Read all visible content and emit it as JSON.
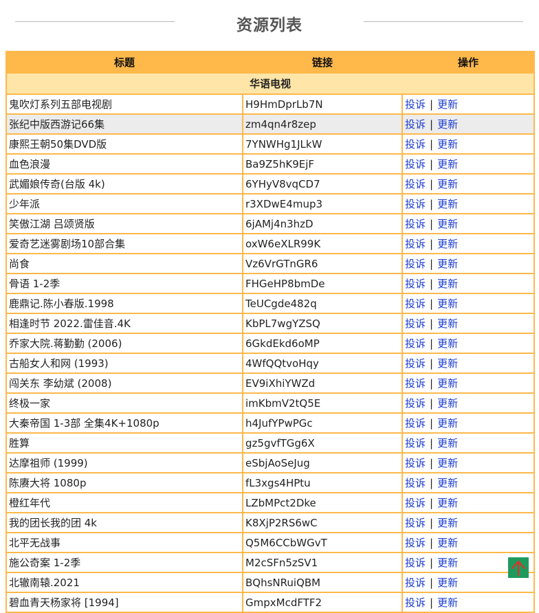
{
  "page": {
    "title": "资源列表"
  },
  "table": {
    "headers": [
      "标题",
      "链接",
      "操作"
    ],
    "category": "华语电视",
    "complain_label": "投诉",
    "separator": "|",
    "update_label": "更新",
    "rows": [
      {
        "title": "鬼吹灯系列五部电视剧",
        "link": "H9HmDprLb7N"
      },
      {
        "title": "张纪中版西游记66集",
        "link": "zm4qn4r8zep"
      },
      {
        "title": "康熙王朝50集DVD版",
        "link": "7YNWHg1JLkW"
      },
      {
        "title": "血色浪漫",
        "link": "Ba9Z5hK9EjF"
      },
      {
        "title": "武媚娘传奇(台版 4k)",
        "link": "6YHyV8vqCD7"
      },
      {
        "title": "少年派",
        "link": "r3XDwE4mup3"
      },
      {
        "title": "笑傲江湖 吕颂贤版",
        "link": "6jAMj4n3hzD"
      },
      {
        "title": "爱奇艺迷雾剧场10部合集",
        "link": "oxW6eXLR99K"
      },
      {
        "title": "尚食",
        "link": "Vz6VrGTnGR6"
      },
      {
        "title": "骨语 1-2季",
        "link": "FHGeHP8bmDe"
      },
      {
        "title": "鹿鼎记.陈小春版.1998",
        "link": "TeUCgde482q"
      },
      {
        "title": "相逢时节 2022.雷佳音.4K",
        "link": "KbPL7wgYZSQ"
      },
      {
        "title": "乔家大院.蒋勤勤 (2006)",
        "link": "6GkdEkd6oMP"
      },
      {
        "title": "古船女人和网 (1993)",
        "link": "4WfQQtvoHqy"
      },
      {
        "title": "闯关东 李幼斌 (2008)",
        "link": "EV9iXhiYWZd"
      },
      {
        "title": "终极一家",
        "link": "imKbmV2tQ5E"
      },
      {
        "title": "大秦帝国 1-3部 全集4K+1080p",
        "link": "h4JufYPwPGc"
      },
      {
        "title": "胜算",
        "link": "gz5gvfTGg6X"
      },
      {
        "title": "达摩祖师 (1999)",
        "link": "eSbjAoSeJug"
      },
      {
        "title": "陈赓大将 1080p",
        "link": "fL3xgs4HPtu"
      },
      {
        "title": "橙红年代",
        "link": "LZbMPct2Dke"
      },
      {
        "title": "我的团长我的团 4k",
        "link": "K8XjP2RS6wC"
      },
      {
        "title": "北平无战事",
        "link": "Q5M6CCbWGvT"
      },
      {
        "title": "施公奇案 1-2季",
        "link": "M2cSFn5zSV1"
      },
      {
        "title": "北辙南辕.2021",
        "link": "BQhsNRuiQBM"
      },
      {
        "title": "碧血青天杨家将 [1994]",
        "link": "GmpxMcdFTF2"
      }
    ]
  },
  "icons": {
    "back_to_top": "arrow-up-icon"
  },
  "colors": {
    "header_bg": "#ffb84a",
    "category_bg": "#ffe6a8",
    "link": "#1a3bd1",
    "back_to_top_bg": "#1f9a5e",
    "back_to_top_arrow": "#e0322b"
  }
}
